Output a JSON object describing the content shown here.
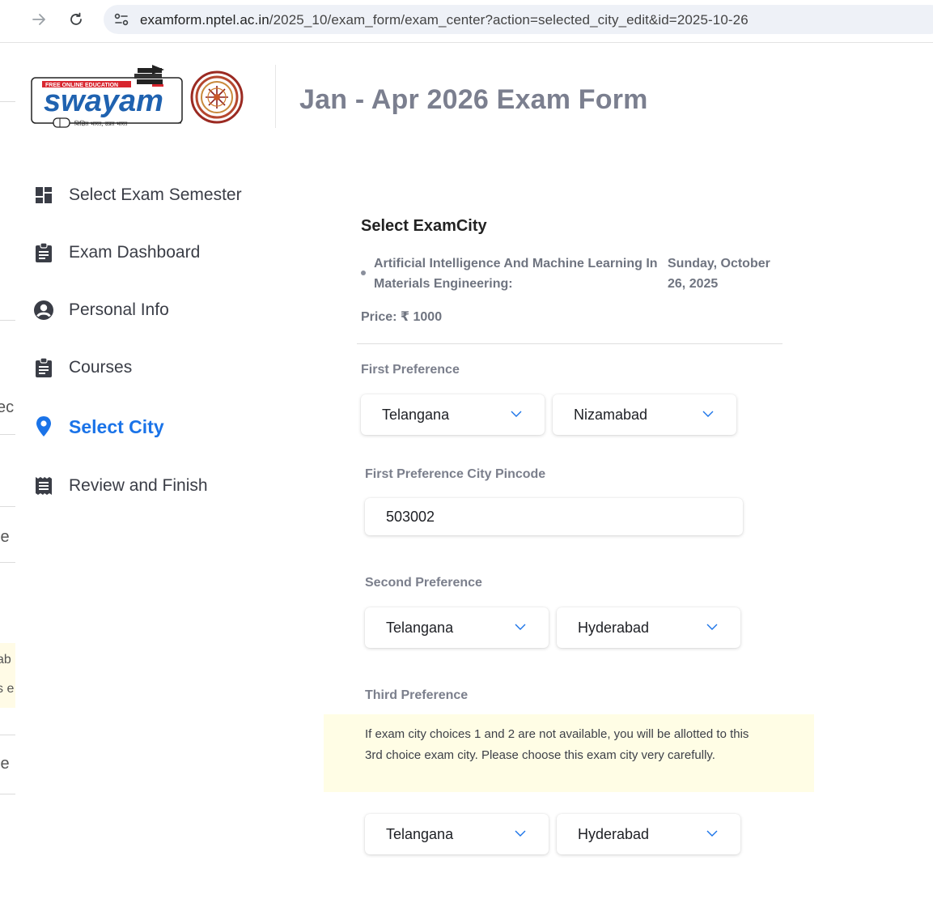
{
  "browser": {
    "url_host": "examform.nptel.ac.in",
    "url_path": "/2025_10/exam_form/exam_center?action=selected_city_edit&id=2025-10-26"
  },
  "header": {
    "logo_tagline": "FREE ONLINE EDUCATION",
    "logo_word": "swayam",
    "logo_subtext": "शिक्षित भारत, उन्नत भारत",
    "title": "Jan - Apr 2026 Exam Form"
  },
  "sidebar": {
    "items": [
      {
        "label": "Select Exam Semester",
        "icon": "dashboard-icon"
      },
      {
        "label": "Exam Dashboard",
        "icon": "clipboard-icon"
      },
      {
        "label": "Personal Info",
        "icon": "user-circle-icon"
      },
      {
        "label": "Courses",
        "icon": "clipboard-icon"
      },
      {
        "label": "Select City",
        "icon": "location-pin-icon",
        "active": true
      },
      {
        "label": "Review and Finish",
        "icon": "receipt-icon"
      }
    ]
  },
  "form": {
    "section_title": "Select ExamCity",
    "course_name": "Artificial Intelligence And Machine Learning In Materials Engineering:",
    "course_date": "Sunday, October 26, 2025",
    "price": "Price: ₹ 1000",
    "first_pref_label": "First Preference",
    "first_state": "Telangana",
    "first_city": "Nizamabad",
    "pincode_label": "First Preference City Pincode",
    "pincode_value": "503002",
    "second_pref_label": "Second Preference",
    "second_state": "Telangana",
    "second_city": "Hyderabad",
    "third_pref_label": "Third Preference",
    "third_notice": "If exam city choices 1 and 2 are not available, you will be allotted to this 3rd choice exam city. Please choose this exam city very carefully.",
    "third_state": "Telangana",
    "third_city": "Hyderabad"
  },
  "colors": {
    "accent": "#1a73e8",
    "notice_bg": "#fffde5",
    "title_gray": "#7b7f8f"
  }
}
